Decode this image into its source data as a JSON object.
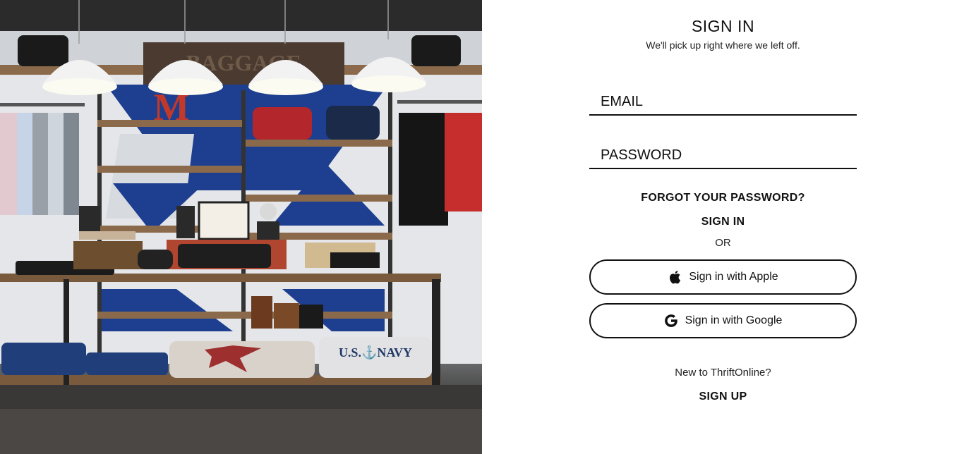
{
  "signin": {
    "title": "SIGN IN",
    "subtitle": "We'll pick up right where we left off.",
    "email_placeholder": "EMAIL",
    "password_placeholder": "PASSWORD",
    "forgot_label": "FORGOT YOUR PASSWORD?",
    "signin_label": "SIGN IN",
    "or_label": "OR",
    "apple_label": "Sign in with Apple",
    "apple_icon": "apple-icon",
    "google_label": "Sign in with Google",
    "google_icon": "google-icon",
    "new_user_text": "New to ThriftOnline?",
    "signup_label": "SIGN UP"
  },
  "hero_image": {
    "shop_sign_text": "BAGGAGE",
    "sweater_text": "U.S.⚓NAVY"
  },
  "colors": {
    "text": "#111111",
    "background": "#ffffff",
    "border": "#111111"
  }
}
